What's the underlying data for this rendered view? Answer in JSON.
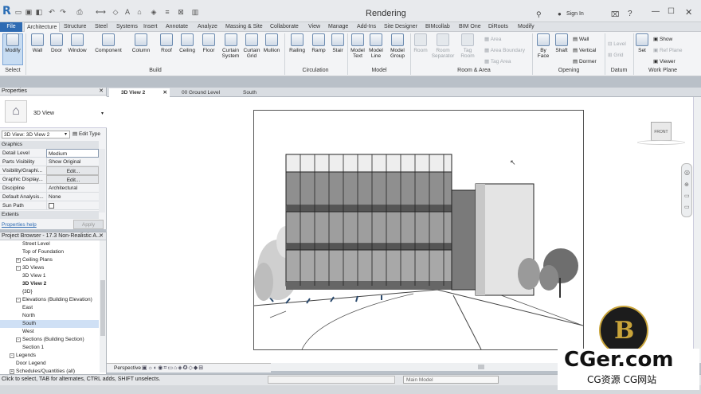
{
  "app": {
    "logo": "R",
    "title": "Rendering",
    "signin": "Sign In"
  },
  "tabs": [
    "File",
    "Architecture",
    "Structure",
    "Steel",
    "Systems",
    "Insert",
    "Annotate",
    "Analyze",
    "Massing & Site",
    "Collaborate",
    "View",
    "Manage",
    "Add-Ins",
    "Site Designer",
    "BIMcollab",
    "BIM One",
    "DiRoots",
    "Modify"
  ],
  "ribbon": {
    "select": {
      "modify": "Modify",
      "title": "Select"
    },
    "build": [
      "Wall",
      "Door",
      "Window",
      "Component",
      "Column",
      "Roof",
      "Ceiling",
      "Floor",
      "Curtain System",
      "Curtain Grid",
      "Mullion"
    ],
    "build_title": "Build",
    "circulation": [
      "Railing",
      "Ramp",
      "Stair"
    ],
    "circulation_title": "Circulation",
    "model": [
      "Model Text",
      "Model Line",
      "Model Group"
    ],
    "model_title": "Model",
    "room": [
      "Room",
      "Room Separator",
      "Tag Room",
      "Area",
      "Area Boundary",
      "Tag Area"
    ],
    "room_title": "Room & Area",
    "opening": [
      "By Face",
      "Shaft",
      "Wall",
      "Vertical",
      "Dormer"
    ],
    "opening_title": "Opening",
    "datum": [
      "Level",
      "Grid"
    ],
    "datum_title": "Datum",
    "workplane": [
      "Set",
      "Show",
      "Ref Plane",
      "Viewer"
    ],
    "workplane_title": "Work Plane"
  },
  "properties": {
    "title": "Properties",
    "type_name": "3D View",
    "selector": "3D View: 3D View 2",
    "edit_type": "Edit Type",
    "section_graphics": "Graphics",
    "rows": [
      {
        "k": "Detail Level",
        "v": "Medium"
      },
      {
        "k": "Parts Visibility",
        "v": "Show Original"
      },
      {
        "k": "Visibility/Graphi...",
        "v": "Edit..."
      },
      {
        "k": "Graphic Display...",
        "v": "Edit..."
      },
      {
        "k": "Discipline",
        "v": "Architectural"
      },
      {
        "k": "Default Analysis...",
        "v": "None"
      },
      {
        "k": "Sun Path",
        "v": ""
      }
    ],
    "section_extents": "Extents",
    "help": "Properties help",
    "apply": "Apply"
  },
  "browser": {
    "title": "Project Browser - 17.3 Non-Realistic A...",
    "items": [
      {
        "label": "Street Level",
        "indent": 3
      },
      {
        "label": "Top of Foundation",
        "indent": 3
      },
      {
        "label": "Ceiling Plans",
        "indent": 2,
        "toggle": "+"
      },
      {
        "label": "3D Views",
        "indent": 2,
        "toggle": "-"
      },
      {
        "label": "3D View 1",
        "indent": 3
      },
      {
        "label": "3D View 2",
        "indent": 3,
        "bold": true
      },
      {
        "label": "{3D}",
        "indent": 3
      },
      {
        "label": "Elevations (Building Elevation)",
        "indent": 2,
        "toggle": "-"
      },
      {
        "label": "East",
        "indent": 3
      },
      {
        "label": "North",
        "indent": 3
      },
      {
        "label": "South",
        "indent": 3,
        "selected": true
      },
      {
        "label": "West",
        "indent": 3
      },
      {
        "label": "Sections (Building Section)",
        "indent": 2,
        "toggle": "-"
      },
      {
        "label": "Section 1",
        "indent": 3
      },
      {
        "label": "Legends",
        "indent": 1,
        "toggle": "-"
      },
      {
        "label": "Door Legend",
        "indent": 2
      },
      {
        "label": "Schedules/Quantities (all)",
        "indent": 1,
        "toggle": "+"
      }
    ]
  },
  "view_tabs": [
    "3D View 2",
    "00 Ground Level",
    "South"
  ],
  "viewcube": "FRONT",
  "viewbar": {
    "perspective": "Perspective"
  },
  "status": {
    "text": "Click to select, TAB for alternates, CTRL adds, SHIFT unselects.",
    "model": "Main Model"
  },
  "watermark": {
    "big": "CGer.com",
    "small": "CG资源 CG网站"
  },
  "colors": {
    "accent": "#2e6bb3",
    "ribbon": "#f3f4f6",
    "canvas": "#ffffff"
  }
}
